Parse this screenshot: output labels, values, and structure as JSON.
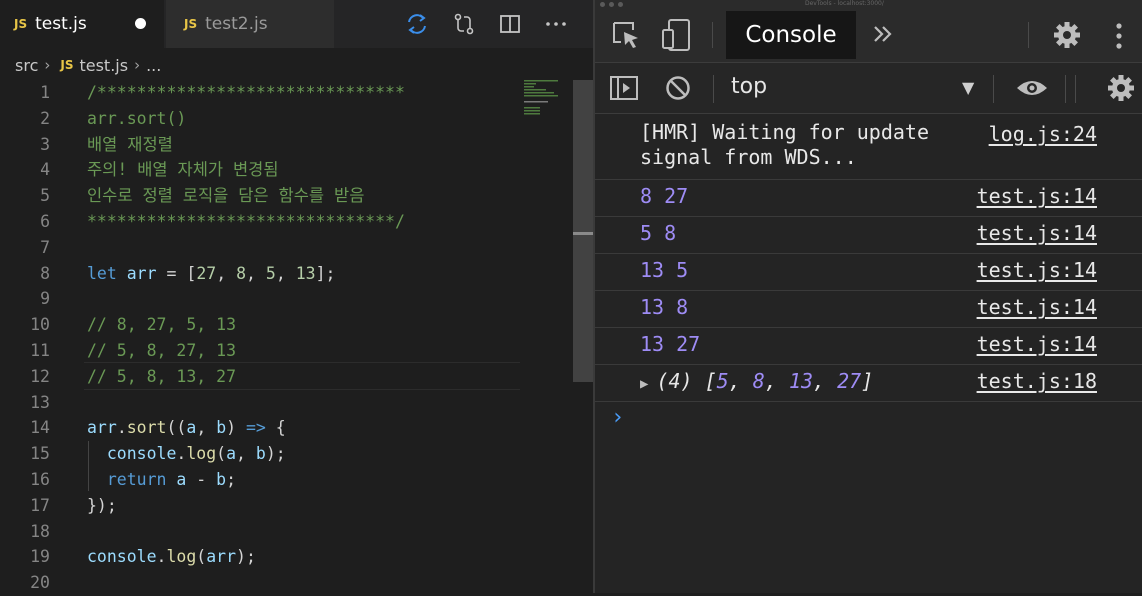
{
  "editor": {
    "tabs": [
      {
        "badge": "JS",
        "label": "test.js"
      },
      {
        "badge": "JS",
        "label": "test2.js"
      }
    ],
    "breadcrumb": {
      "folder": "src",
      "badge": "JS",
      "file": "test.js",
      "more": "..."
    },
    "lines": [
      {
        "n": "1",
        "text": "/*******************************",
        "color": "#6a9955"
      },
      {
        "n": "2",
        "text": "arr.sort()",
        "color": "#6a9955"
      },
      {
        "n": "3",
        "text": "배열 재정렬",
        "color": "#6a9955"
      },
      {
        "n": "4",
        "text": "주의! 배열 자체가 변경됨",
        "color": "#6a9955"
      },
      {
        "n": "5",
        "text": "인수로 정렬 로직을 담은 함수를 받음",
        "color": "#6a9955"
      },
      {
        "n": "6",
        "text": "*******************************/",
        "color": "#6a9955"
      },
      {
        "n": "7",
        "text": "",
        "color": "#d4d4d4"
      },
      {
        "n": "8",
        "text": "let arr = [27, 8, 5, 13];",
        "color": "#d4d4d4"
      },
      {
        "n": "9",
        "text": "",
        "color": "#d4d4d4"
      },
      {
        "n": "10",
        "text": "// 8, 27, 5, 13",
        "color": "#6a9955"
      },
      {
        "n": "11",
        "text": "// 5, 8, 27, 13",
        "color": "#6a9955"
      },
      {
        "n": "12",
        "text": "// 5, 8, 13, 27",
        "color": "#6a9955"
      },
      {
        "n": "13",
        "text": "",
        "color": "#d4d4d4"
      },
      {
        "n": "14",
        "text": "arr.sort((a, b) => {",
        "color": "#d4d4d4"
      },
      {
        "n": "15",
        "text": "  console.log(a, b);",
        "color": "#d4d4d4"
      },
      {
        "n": "16",
        "text": "  return a - b;",
        "color": "#d4d4d4"
      },
      {
        "n": "17",
        "text": "});",
        "color": "#d4d4d4"
      },
      {
        "n": "18",
        "text": "",
        "color": "#d4d4d4"
      },
      {
        "n": "19",
        "text": "console.log(arr);",
        "color": "#d4d4d4"
      },
      {
        "n": "20",
        "text": "",
        "color": "#d4d4d4"
      }
    ]
  },
  "devtools": {
    "window_title": "DevTools - localhost:3000/",
    "console_tab": "Console",
    "context": "top",
    "messages": [
      {
        "text": "[HMR] Waiting for update\nsignal from WDS...",
        "source": "log.js:24",
        "kind": "info"
      },
      {
        "text": "8 27",
        "source": "test.js:14",
        "kind": "num"
      },
      {
        "text": "5 8",
        "source": "test.js:14",
        "kind": "num"
      },
      {
        "text": "13 5",
        "source": "test.js:14",
        "kind": "num"
      },
      {
        "text": "13 8",
        "source": "test.js:14",
        "kind": "num"
      },
      {
        "text": "13 27",
        "source": "test.js:14",
        "kind": "num"
      }
    ],
    "array_log": {
      "prefix": "(4) [",
      "values": [
        "5",
        "8",
        "13",
        "27"
      ],
      "suffix": "]",
      "source": "test.js:18"
    },
    "prompt": "›"
  },
  "colors": {
    "accent": "#4a9cf7",
    "number": "#9e8cf5",
    "comment": "#6a9955",
    "js_badge": "#e8c547"
  }
}
